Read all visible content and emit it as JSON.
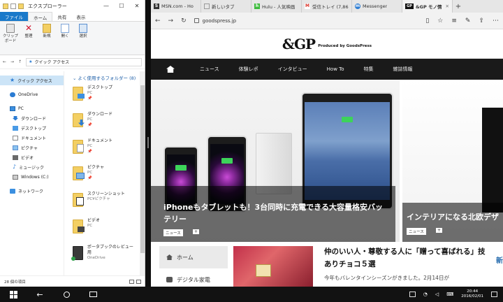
{
  "explorer": {
    "title": "エクスプローラー",
    "window_controls": [
      "—",
      "☐",
      "✕"
    ],
    "tabs": [
      "ファイル",
      "ホーム",
      "共有",
      "表示"
    ],
    "ribbon": [
      {
        "label": "クリップボード",
        "icon": "clipboard-icon"
      },
      {
        "label": "整理",
        "icon": "delete-icon"
      },
      {
        "label": "新規",
        "icon": "new-folder-icon"
      },
      {
        "label": "開く",
        "icon": "open-icon"
      },
      {
        "label": "選択",
        "icon": "select-icon"
      }
    ],
    "address": {
      "path": "クイック アクセス",
      "back": "←",
      "forward": "→",
      "up": "↑"
    },
    "nav": [
      {
        "label": "クイック アクセス",
        "icon": "star-icon",
        "selected": true
      },
      {
        "label": "OneDrive",
        "icon": "onedrive-icon"
      },
      {
        "label": "PC",
        "icon": "pc-icon"
      },
      {
        "label": "ダウンロード",
        "icon": "download-icon"
      },
      {
        "label": "デスクトップ",
        "icon": "desktop-icon"
      },
      {
        "label": "ドキュメント",
        "icon": "document-icon"
      },
      {
        "label": "ピクチャ",
        "icon": "picture-icon"
      },
      {
        "label": "ビデオ",
        "icon": "video-icon"
      },
      {
        "label": "ミュージック",
        "icon": "music-icon"
      },
      {
        "label": "Windows (C:)",
        "icon": "drive-icon"
      },
      {
        "label": "ネットワーク",
        "icon": "network-icon"
      }
    ],
    "group_title": "よく使用するフォルダー (8)",
    "folders": [
      {
        "name": "デスクトップ",
        "sub": "PC",
        "pin": "📌"
      },
      {
        "name": "ダウンロード",
        "sub": "PC",
        "pin": "📌"
      },
      {
        "name": "ドキュメント",
        "sub": "PC",
        "pin": "📌"
      },
      {
        "name": "ピクチャ",
        "sub": "PC",
        "pin": "📌"
      },
      {
        "name": "スクリーンショット",
        "sub": "PC¥ピクチャ",
        "pin": ""
      },
      {
        "name": "ビデオ",
        "sub": "PC",
        "pin": ""
      },
      {
        "name": "ポータブックのレビュー用",
        "sub": "OneDrive",
        "pin": ""
      }
    ],
    "status": "28 個の項目"
  },
  "browser": {
    "tabs": [
      {
        "label": "MSN.com - Ho",
        "fav_color": "#333333",
        "fav_text": "S"
      },
      {
        "label": "新しいタブ",
        "fav_color": "#999999",
        "fav_text": ""
      },
      {
        "label": "Hulu - 人気映画",
        "fav_color": "#3dbb3d",
        "fav_text": "h"
      },
      {
        "label": "受信トレイ (7,86",
        "fav_color": "#d93025",
        "fav_text": "M"
      },
      {
        "label": "Messenger",
        "fav_color": "#2b7cd3",
        "fav_text": "m"
      },
      {
        "label": "&GP モノ情",
        "fav_color": "#111111",
        "fav_text": "GP",
        "active": true
      }
    ],
    "url": "goodspress.jp",
    "site": {
      "logo": "&GP",
      "logo_sub": "Produced by GoodsPress",
      "nav": [
        "ニュース",
        "体験レポ",
        "インタビュー",
        "How To",
        "特集",
        "雑誌情報"
      ],
      "hero_title": "iPhoneもタブレットも！3台同時に充電できる大容量格安バッテリー",
      "hero_tag": "ニュース",
      "hero2_title": "インテリアになる北欧デザ",
      "hero2_tag": "ニュース",
      "side": [
        "ホーム",
        "デジタル家電"
      ],
      "article_title": "仲のいい人・尊敬する人に「贈って喜ばれる」技ありチョコ５選",
      "article_sub": "今年もバレンタインシーズンがきました。2月14日が",
      "article_extra": "新"
    }
  },
  "taskbar": {
    "time": "20:44",
    "date": "2016/02/01"
  }
}
